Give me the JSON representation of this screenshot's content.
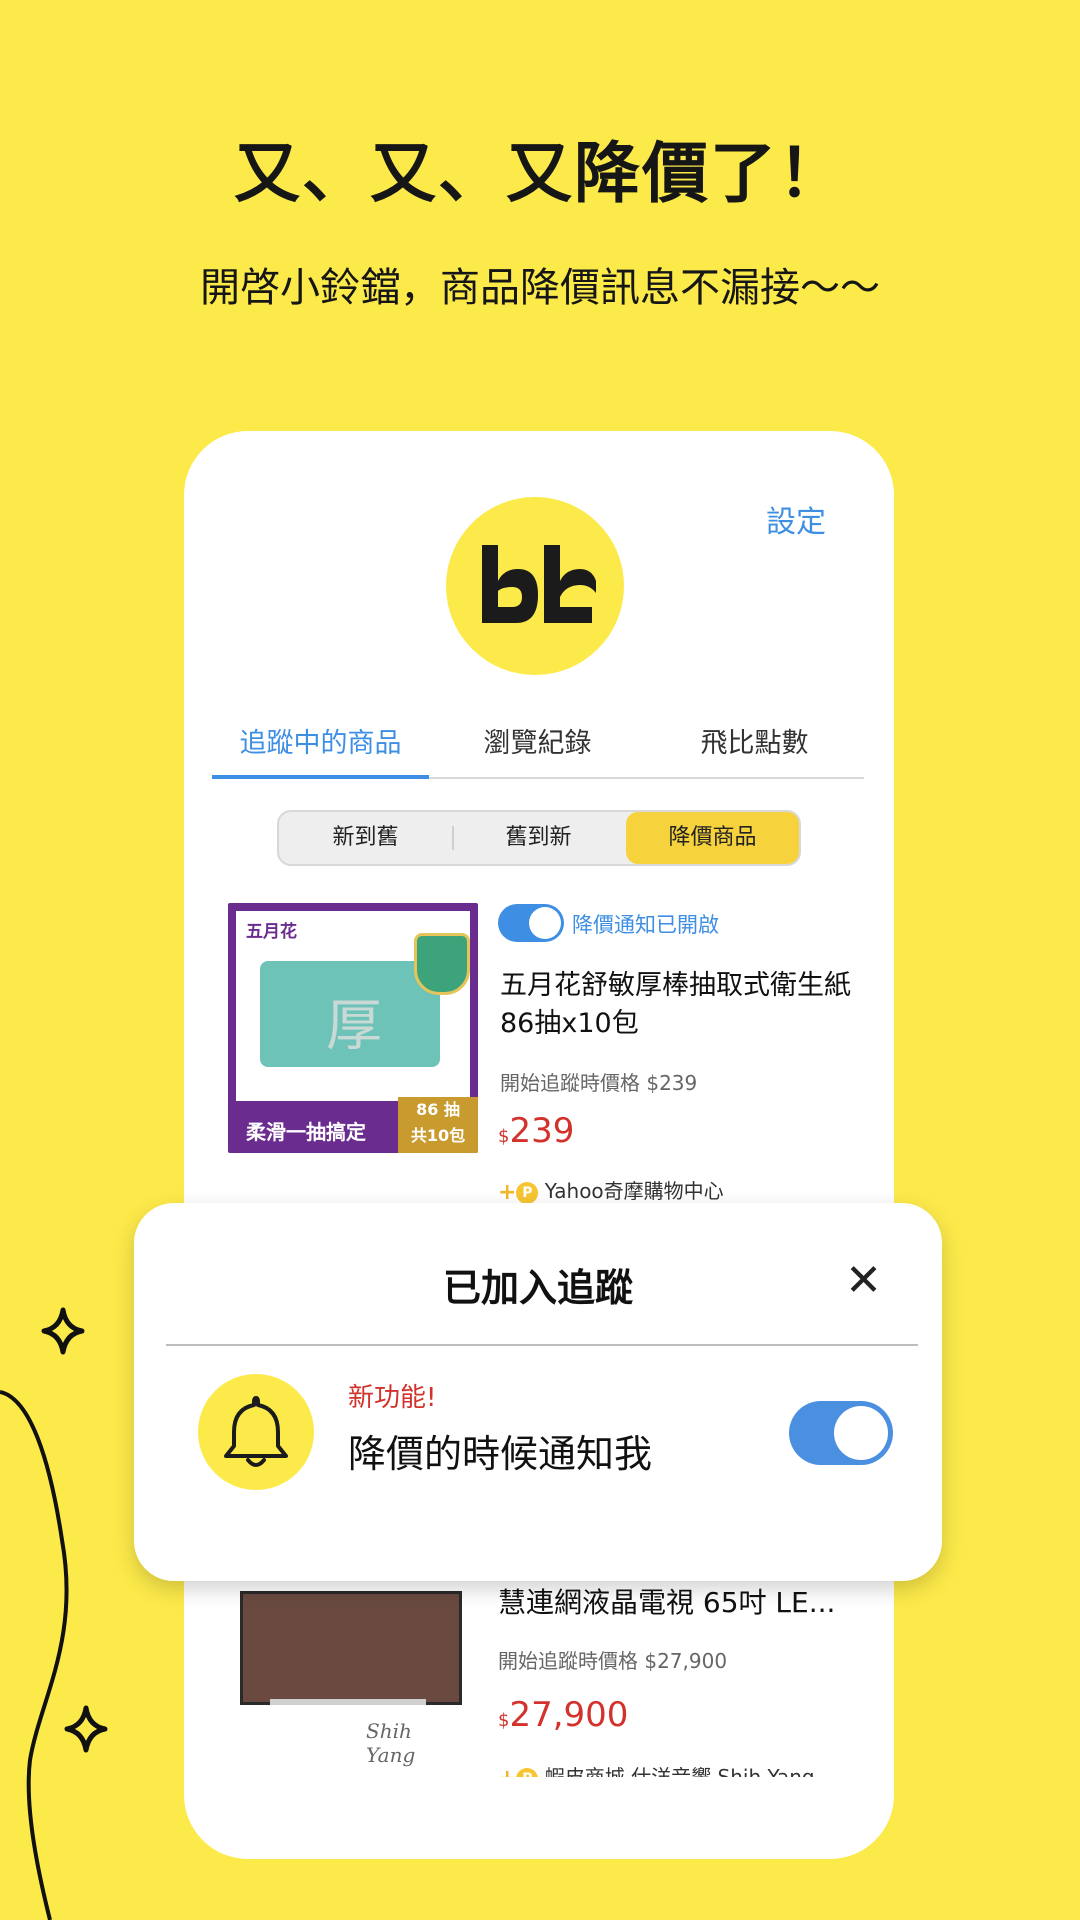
{
  "colors": {
    "background": "#FCEA4A",
    "accent_blue": "#3E8FE3",
    "price_red": "#D3322C",
    "segment_active": "#F6D23C"
  },
  "promo": {
    "headline": "又、又、又降價了！",
    "subline": "開啓小鈴鐺，商品降價訊息不漏接～～"
  },
  "profile": {
    "settings_label": "設定",
    "logo_icon": "bibi-logo-icon"
  },
  "tabs": [
    {
      "label": "追蹤中的商品",
      "active": true
    },
    {
      "label": "瀏覽紀錄",
      "active": false
    },
    {
      "label": "飛比點數",
      "active": false
    }
  ],
  "segments": [
    {
      "label": "新到舊",
      "active": false
    },
    {
      "label": "舊到新",
      "active": false
    },
    {
      "label": "降價商品",
      "active": true
    }
  ],
  "products": [
    {
      "brand": "五月花",
      "image_slogan": "柔滑一抽搞定",
      "image_count": "86 抽",
      "image_pack": "共10包",
      "notify_label": "降價通知已開啟",
      "notify_on": true,
      "title": "五月花舒敏厚棒抽取式衛生紙86抽x10包",
      "start_price_text": "開始追蹤時價格 $239",
      "currency": "$",
      "price": "239",
      "store": "Yahoo奇摩購物中心"
    },
    {
      "title": "慧連網液晶電視 65吋 LE...",
      "start_price_text": "開始追蹤時價格 $27,900",
      "currency": "$",
      "price": "27,900",
      "store": "蝦皮商城 仕洋音響 Shih Yang",
      "watermark": "Shih Yang"
    }
  ],
  "popup": {
    "title": "已加入追蹤",
    "close_icon": "close-icon",
    "new_feature_label": "新功能!",
    "notify_text": "降價的時候通知我",
    "toggle_on": true
  }
}
